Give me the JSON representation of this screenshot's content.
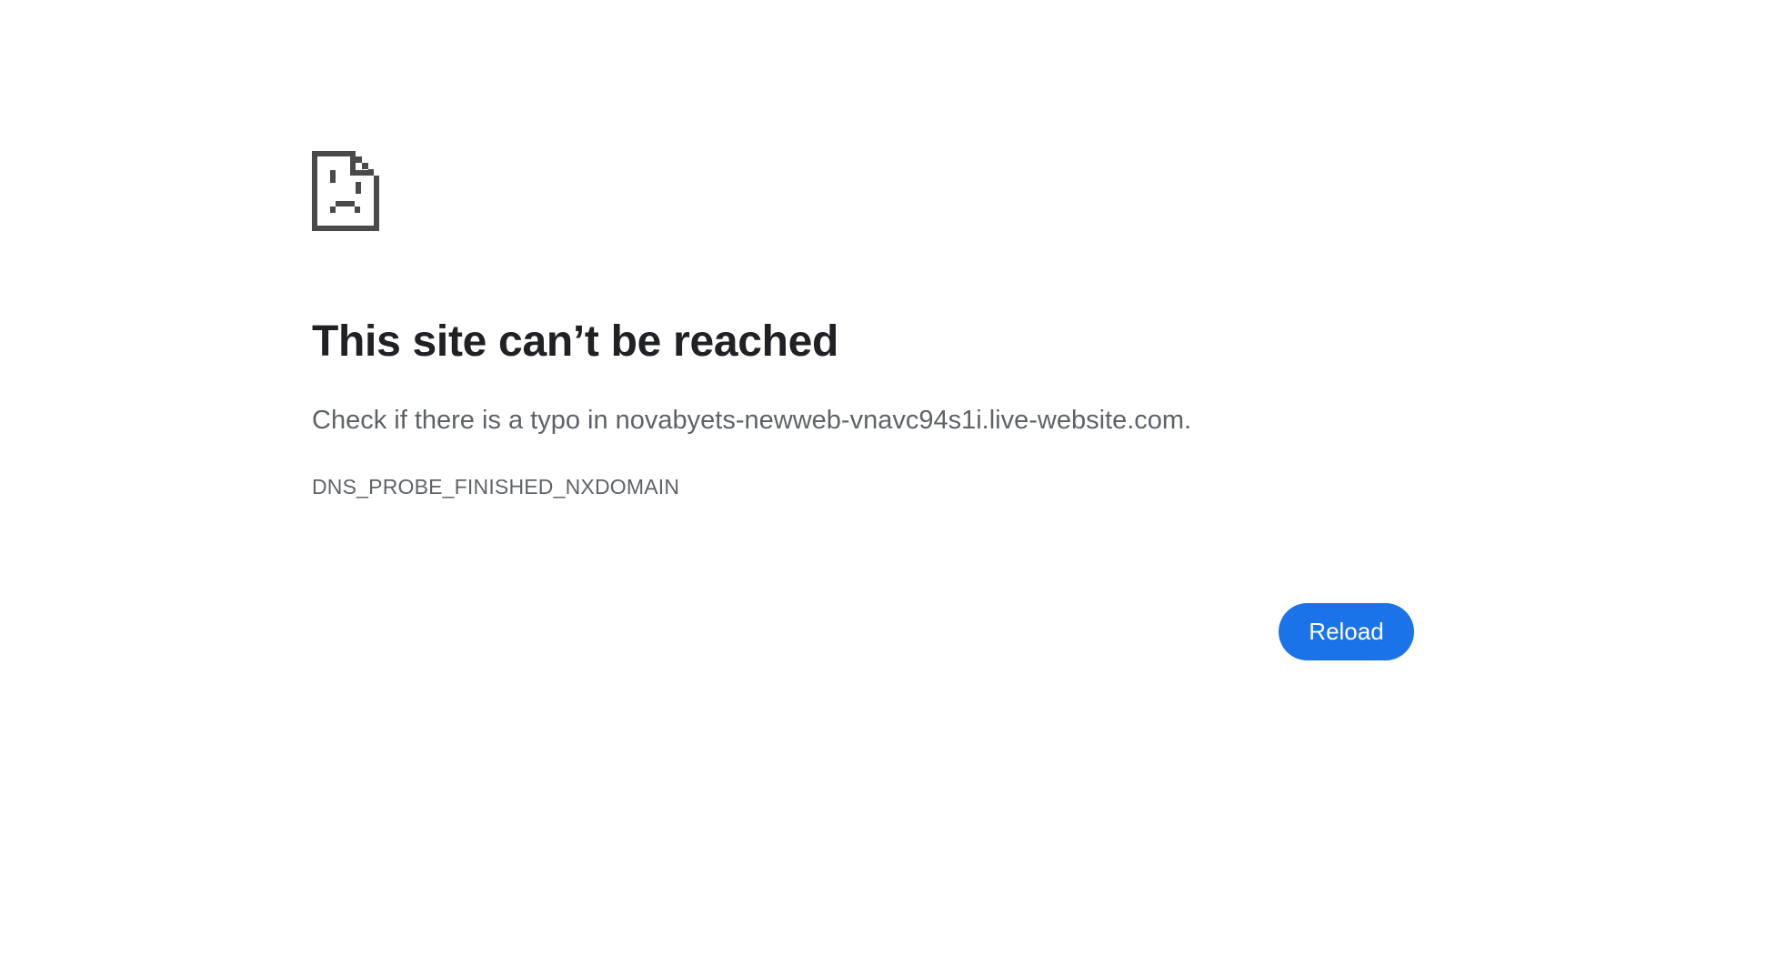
{
  "error_page": {
    "icon": "sad-page-icon",
    "title": "This site can’t be reached",
    "message": "Check if there is a typo in novabyets-newweb-vnavc94s1i.live-website.com.",
    "error_code": "DNS_PROBE_FINISHED_NXDOMAIN",
    "reload_label": "Reload"
  },
  "colors": {
    "title": "#202124",
    "body_text": "#5f6368",
    "button_bg": "#1a73e8",
    "button_text": "#ffffff",
    "icon": "#4a4a4a"
  }
}
